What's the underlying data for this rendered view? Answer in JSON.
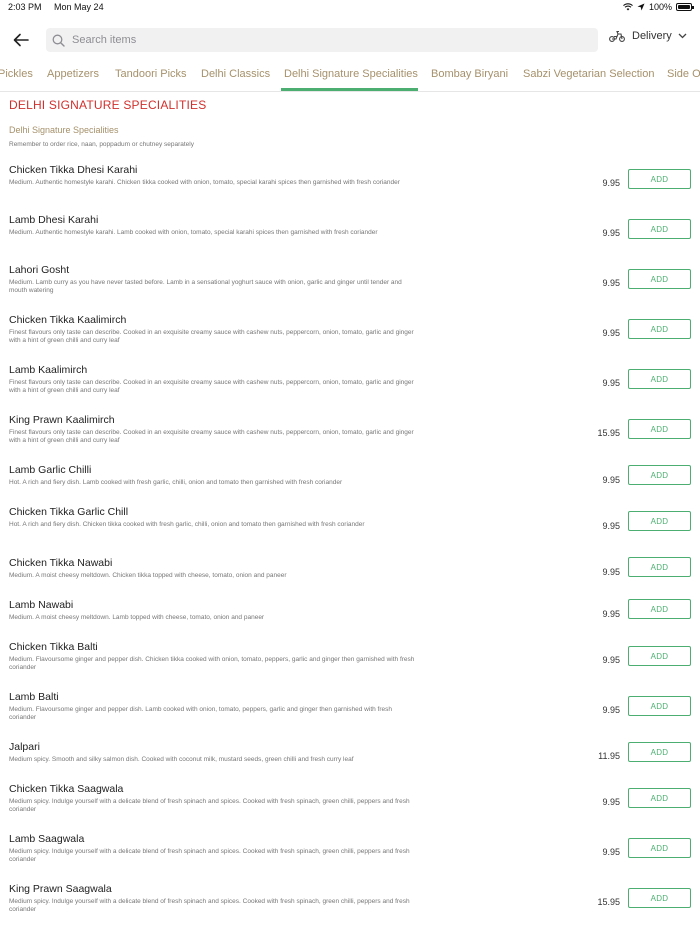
{
  "status": {
    "time": "2:03 PM",
    "date": "Mon May 24",
    "battery": "100%"
  },
  "search": {
    "placeholder": "Search items"
  },
  "delivery_label": "Delivery",
  "tabs": [
    "Pickles",
    "Appetizers",
    "Tandoori Picks",
    "Delhi Classics",
    "Delhi Signature Specialities",
    "Bombay Biryani",
    "Sabzi Vegetarian Selection",
    "Side Orders"
  ],
  "active_tab": "Delhi Signature Specialities",
  "section_title": "DELHI SIGNATURE SPECIALITIES",
  "category": {
    "name": "Delhi Signature Specialities",
    "note": "Remember to order rice, naan, poppadum or chutney separately"
  },
  "add_label": "ADD",
  "colors": {
    "accent": "#4caf71",
    "section_title": "#d0302c",
    "tab_text": "#a6916b"
  },
  "items": [
    {
      "name": "Chicken Tikka Dhesi Karahi",
      "desc": "Medium. Authentic homestyle karahi. Chicken tikka cooked with onion, tomato, special karahi spices then garnished with fresh coriander",
      "price": "9.95"
    },
    {
      "name": "Lamb Dhesi Karahi",
      "desc": "Medium. Authentic homestyle karahi. Lamb cooked with onion, tomato, special karahi spices then garnished with fresh coriander",
      "price": "9.95"
    },
    {
      "name": "Lahori Gosht",
      "desc": "Medium. Lamb curry as you have never tasted before. Lamb in a sensational yoghurt sauce with onion, garlic and ginger until tender and mouth watering",
      "price": "9.95"
    },
    {
      "name": "Chicken Tikka Kaalimirch",
      "desc": "Finest flavours only taste can describe. Cooked in an exquisite creamy sauce with cashew nuts, peppercorn, onion, tomato, garlic and ginger with a hint of green chilli and curry leaf",
      "price": "9.95"
    },
    {
      "name": "Lamb Kaalimirch",
      "desc": "Finest flavours only taste can describe. Cooked in an exquisite creamy sauce with cashew nuts, peppercorn, onion, tomato, garlic and ginger with a hint of green chilli and curry leaf",
      "price": "9.95"
    },
    {
      "name": "King Prawn Kaalimirch",
      "desc": "Finest flavours only taste can describe. Cooked in an exquisite creamy sauce with cashew nuts, peppercorn, onion, tomato, garlic and ginger with a hint of green chilli and curry leaf",
      "price": "15.95"
    },
    {
      "name": "Lamb Garlic Chilli",
      "desc": "Hot. A rich and fiery dish. Lamb cooked with fresh garlic, chilli, onion and tomato then garnished with fresh coriander",
      "price": "9.95"
    },
    {
      "name": "Chicken Tikka Garlic Chill",
      "desc": "Hot. A rich and fiery dish. Chicken tikka cooked with fresh garlic, chilli, onion and tomato then garnished with fresh coriander",
      "price": "9.95"
    },
    {
      "name": "Chicken Tikka Nawabi",
      "desc": "Medium. A moist cheesy meltdown. Chicken tikka topped with cheese, tomato, onion and paneer",
      "price": "9.95"
    },
    {
      "name": "Lamb Nawabi",
      "desc": "Medium. A moist cheesy meltdown. Lamb topped with cheese, tomato, onion and paneer",
      "price": "9.95"
    },
    {
      "name": "Chicken Tikka Balti",
      "desc": "Medium. Flavoursome ginger and pepper dish. Chicken tikka cooked with onion, tomato, peppers, garlic and ginger then garnished with fresh coriander",
      "price": "9.95"
    },
    {
      "name": "Lamb Balti",
      "desc": "Medium. Flavoursome ginger and pepper dish. Lamb cooked with onion, tomato, peppers, garlic and ginger then garnished with fresh coriander",
      "price": "9.95"
    },
    {
      "name": "Jalpari",
      "desc": "Medium spicy. Smooth and silky salmon dish. Cooked with coconut milk, mustard seeds, green chilli and fresh curry leaf",
      "price": "11.95"
    },
    {
      "name": "Chicken Tikka Saagwala",
      "desc": "Medium spicy. Indulge yourself with a delicate blend of fresh spinach and spices. Cooked with fresh spinach, green chilli, peppers and fresh coriander",
      "price": "9.95"
    },
    {
      "name": "Lamb Saagwala",
      "desc": "Medium spicy. Indulge yourself with a delicate blend of fresh spinach and spices. Cooked with fresh spinach, green chilli, peppers and fresh coriander",
      "price": "9.95"
    },
    {
      "name": "King Prawn Saagwala",
      "desc": "Medium spicy. Indulge yourself with a delicate blend of fresh spinach and spices. Cooked with fresh spinach, green chilli, peppers and fresh coriander",
      "price": "15.95"
    }
  ]
}
